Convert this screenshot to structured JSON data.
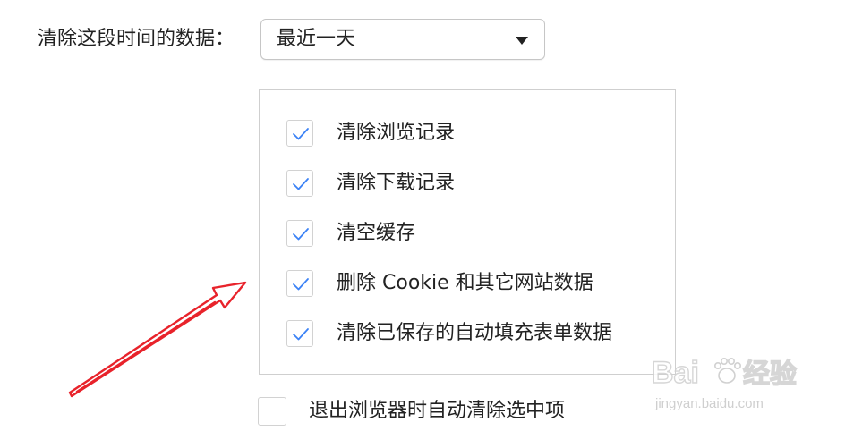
{
  "time_range": {
    "label": "清除这段时间的数据：",
    "selected": "最近一天"
  },
  "options": [
    {
      "label": "清除浏览记录",
      "checked": true
    },
    {
      "label": "清除下载记录",
      "checked": true
    },
    {
      "label": "清空缓存",
      "checked": true
    },
    {
      "label": "删除 Cookie 和其它网站数据",
      "checked": true
    },
    {
      "label": "清除已保存的自动填充表单数据",
      "checked": true
    }
  ],
  "exit_option": {
    "label": "退出浏览器时自动清除选中项",
    "checked": false
  },
  "colors": {
    "checkmark": "#3b82f6",
    "annotation_arrow": "#e8232b"
  },
  "watermark": {
    "brand": "Bai du 经验",
    "url": "jingyan.baidu.com"
  }
}
